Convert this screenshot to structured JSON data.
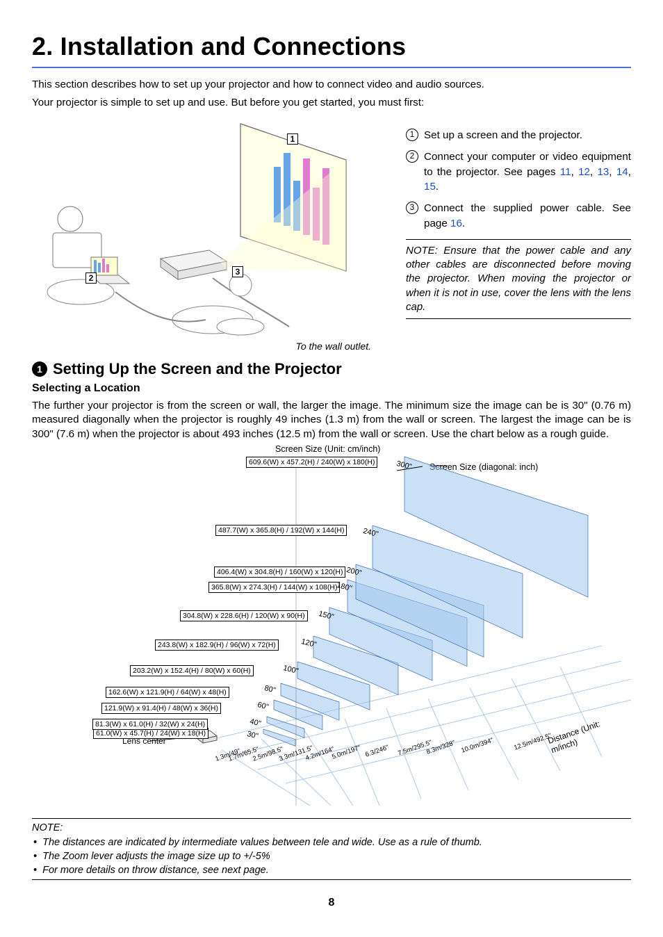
{
  "chapter_title": "2. Installation and Connections",
  "intro_line1": "This section describes how to set up your projector and how to connect video and audio sources.",
  "intro_line2": "Your projector is simple to set up and use. But before you get started, you must first:",
  "illustration_caption": "To the wall outlet.",
  "steps": [
    {
      "num": "1",
      "text_segments": [
        "Set up a screen and the projector."
      ]
    },
    {
      "num": "2",
      "text_segments": [
        "Connect your computer or video equipment to the projector. See pages ",
        {
          "link": "11"
        },
        ", ",
        {
          "link": "12"
        },
        ", ",
        {
          "link": "13"
        },
        ", ",
        {
          "link": "14"
        },
        ", ",
        {
          "link": "15"
        },
        "."
      ]
    },
    {
      "num": "3",
      "text_segments": [
        "Connect the supplied power cable. See page ",
        {
          "link": "16"
        },
        "."
      ]
    }
  ],
  "note_text": "NOTE: Ensure that the power cable and any other cables are disconnected before moving the projector. When moving the projector or when it is not in use, cover the lens with the lens cap.",
  "section_number": "1",
  "section_title": "Setting Up the Screen and the Projector",
  "sub_title": "Selecting a Location",
  "selecting_body": "The further your projector is from the screen or wall, the larger the image. The minimum size the image can be is 30\" (0.76 m) measured diagonally when the projector is roughly 49 inches (1.3 m) from the wall or screen. The largest the image can be is 300\" (7.6 m) when the projector is about 493 inches (12.5 m) from the wall or screen. Use the chart below as a rough guide.",
  "callouts": {
    "c1": "1",
    "c2": "2",
    "c3": "3"
  },
  "chart_data": {
    "type": "table",
    "title": "Screen Size (Unit: cm/inch)",
    "legend": "Screen Size (diagonal: inch)",
    "lens_center_label": "Lens center",
    "distance_axis_label": "Distance (Unit: m/inch)",
    "rows": [
      {
        "diag": "30\"",
        "size_label": "61.0(W) x 45.7(H) / 24(W) x 18(H)",
        "distance": "1.3m/49\""
      },
      {
        "diag": "40\"",
        "size_label": "81.3(W) x 61.0(H) / 32(W) x 24(H)",
        "distance": "1.7m/65.5\""
      },
      {
        "diag": "60\"",
        "size_label": "121.9(W) x 91.4(H) / 48(W) x 36(H)",
        "distance": "2.5m/98.5\""
      },
      {
        "diag": "80\"",
        "size_label": "162.6(W) x 121.9(H) / 64(W) x 48(H)",
        "distance": "3.3m/131.5\""
      },
      {
        "diag": "100\"",
        "size_label": "203.2(W) x 152.4(H) / 80(W) x 60(H)",
        "distance": "4.2m/164\""
      },
      {
        "diag": "120\"",
        "size_label": "243.8(W) x 182.9(H) / 96(W) x 72(H)",
        "distance": "5.0m/197\""
      },
      {
        "diag": "150\"",
        "size_label": "304.8(W) x 228.6(H) / 120(W) x 90(H)",
        "distance": "6.3/246\""
      },
      {
        "diag": "180\"",
        "size_label": "365.8(W) x 274.3(H) / 144(W) x 108(H)",
        "distance": "7.5m/295.5\""
      },
      {
        "diag": "200\"",
        "size_label": "406.4(W) x 304.8(H) / 160(W) x 120(H)",
        "distance": "8.3m/328\""
      },
      {
        "diag": "240\"",
        "size_label": "487.7(W) x 365.8(H) / 192(W) x 144(H)",
        "distance": "10.0m/394\""
      },
      {
        "diag": "300\"",
        "size_label": "609.6(W) x 457.2(H) / 240(W) x 180(H)",
        "distance": "12.5m/492.5\""
      }
    ]
  },
  "footnotes": {
    "heading": "NOTE:",
    "items": [
      "The distances are indicated by intermediate values between tele and wide. Use as a rule of thumb.",
      "The Zoom lever adjusts the image size up to +/-5%",
      "For more details on throw distance, see next page."
    ]
  },
  "page_number": "8"
}
